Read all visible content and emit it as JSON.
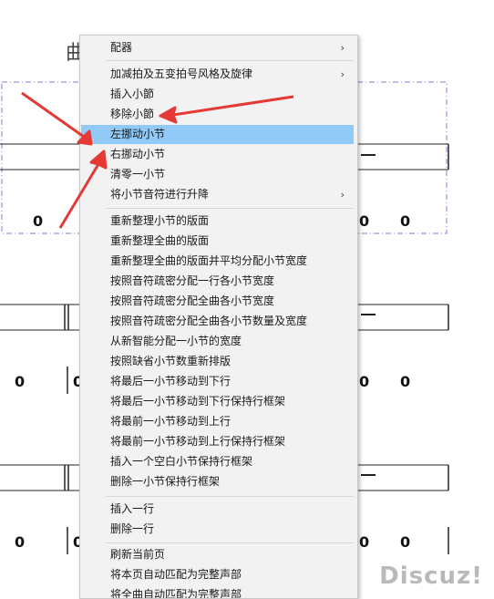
{
  "score": {
    "title_char": "曲",
    "zero": "0",
    "watermark": "Discuz!"
  },
  "menu": {
    "items": [
      {
        "label": "配器",
        "submenu": true
      },
      {
        "label": "加减拍及五变拍号风格及旋律",
        "submenu": true
      },
      {
        "label": "插入小節",
        "submenu": false
      },
      {
        "label": "移除小節",
        "submenu": false
      },
      {
        "label": "左挪动小节",
        "submenu": false,
        "highlighted": true
      },
      {
        "label": "右挪动小节",
        "submenu": false
      },
      {
        "label": "清零一小节",
        "submenu": false
      },
      {
        "label": "将小节音符进行升降",
        "submenu": true
      },
      {
        "label": "重新整理小节的版面",
        "submenu": false
      },
      {
        "label": "重新整理全曲的版面",
        "submenu": false
      },
      {
        "label": "重新整理全曲的版面并平均分配小节宽度",
        "submenu": false
      },
      {
        "label": "按照音符疏密分配一行各小节宽度",
        "submenu": false
      },
      {
        "label": "按照音符疏密分配全曲各小节宽度",
        "submenu": false
      },
      {
        "label": "按照音符疏密分配全曲各小节数量及宽度",
        "submenu": false
      },
      {
        "label": "从新智能分配一小节的宽度",
        "submenu": false
      },
      {
        "label": "按照缺省小节数重新排版",
        "submenu": false
      },
      {
        "label": "将最后一小节移动到下行",
        "submenu": false
      },
      {
        "label": "将最后一小节移动到下行保持行框架",
        "submenu": false
      },
      {
        "label": "将最前一小节移动到上行",
        "submenu": false
      },
      {
        "label": "将最前一小节移动到上行保持行框架",
        "submenu": false
      },
      {
        "label": "插入一个空白小节保持行框架",
        "submenu": false
      },
      {
        "label": "删除一小节保持行框架",
        "submenu": false
      },
      {
        "label": "插入一行",
        "submenu": false
      },
      {
        "label": "删除一行",
        "submenu": false
      },
      {
        "label": "刷新当前页",
        "submenu": false
      },
      {
        "label": "将本页自动匹配为完整声部",
        "submenu": false
      },
      {
        "label": "将全曲自动匹配为完整声部",
        "submenu": false
      }
    ],
    "submenu_glyph": "›"
  },
  "colors": {
    "highlight": "#91c9f7",
    "annotation_arrow": "#e53935",
    "selection_border": "#7b7bdc"
  }
}
